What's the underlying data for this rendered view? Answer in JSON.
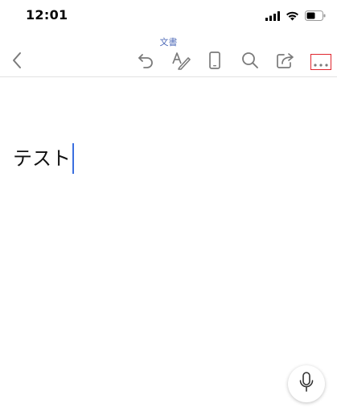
{
  "status_bar": {
    "time": "12:01",
    "icons": [
      "cellular-signal-icon",
      "wifi-icon",
      "battery-icon"
    ]
  },
  "document": {
    "title": "文書",
    "body_text": "テスト"
  },
  "toolbar": {
    "items": [
      "back-icon",
      "undo-icon",
      "format-icon",
      "mobile-view-icon",
      "search-icon",
      "share-icon",
      "more-icon"
    ]
  },
  "colors": {
    "title": "#4f6bb8",
    "icon": "#7a7a7a",
    "caret": "#3b6fe0",
    "highlight_border": "#e0262e"
  },
  "fab": {
    "icon": "microphone-icon"
  }
}
